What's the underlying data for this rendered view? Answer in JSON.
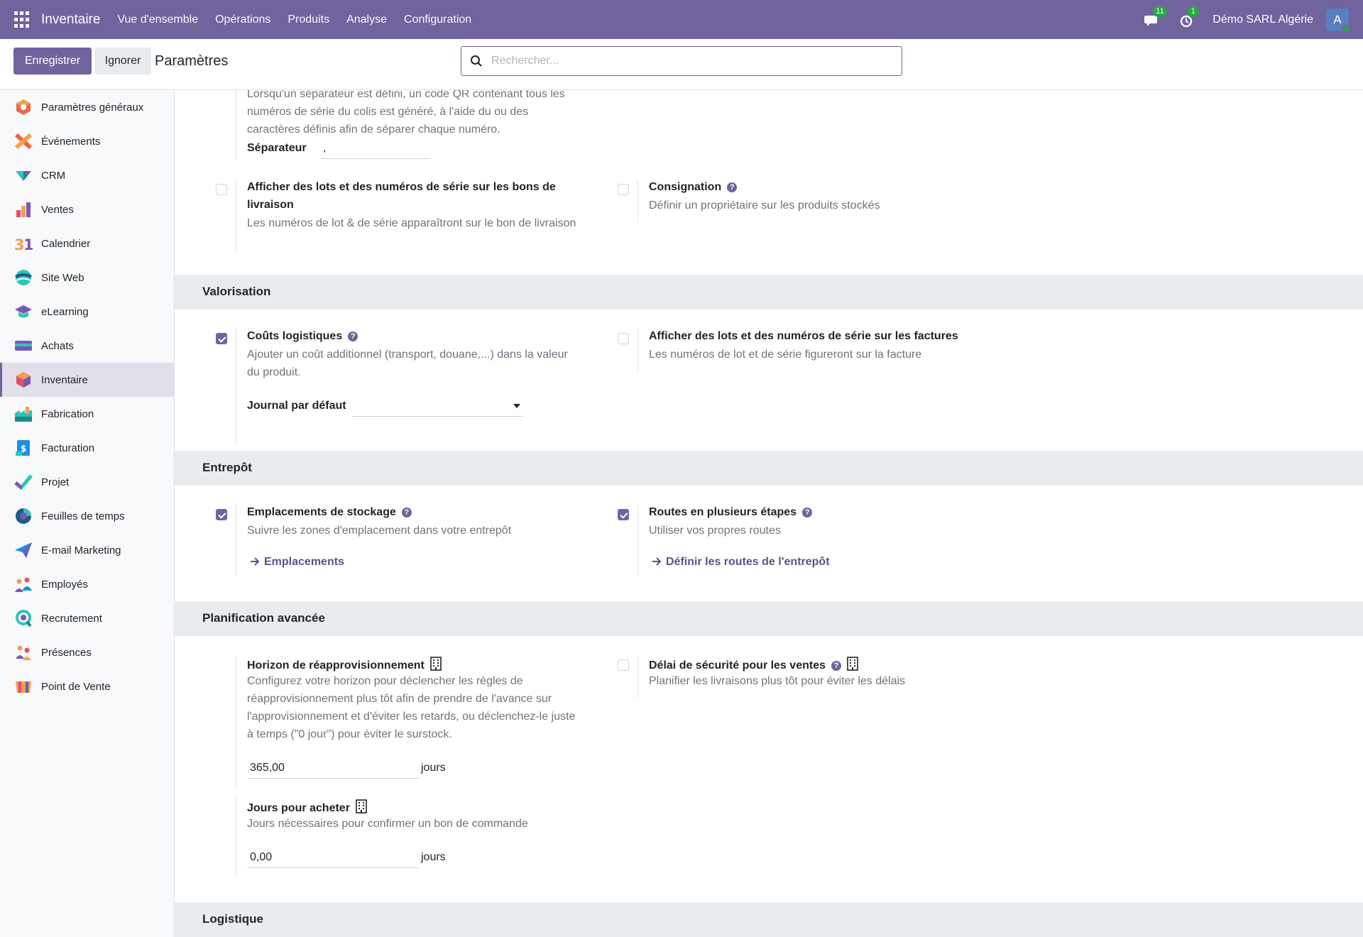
{
  "navbar": {
    "app_name": "Inventaire",
    "menu": [
      "Vue d'ensemble",
      "Opérations",
      "Produits",
      "Analyse",
      "Configuration"
    ],
    "messages_count": "11",
    "activities_count": "1",
    "company": "Démo SARL Algérie",
    "avatar_letter": "A",
    "colors": {
      "brand": "#71639e",
      "badge": "#28a745"
    }
  },
  "control": {
    "save_label": "Enregistrer",
    "discard_label": "Ignorer",
    "title": "Paramètres",
    "search_placeholder": "Rechercher..."
  },
  "sidebar": {
    "items": [
      {
        "label": "Paramètres généraux",
        "icon": "settings-app-icon"
      },
      {
        "label": "Événements",
        "icon": "events-app-icon"
      },
      {
        "label": "CRM",
        "icon": "crm-app-icon"
      },
      {
        "label": "Ventes",
        "icon": "sales-app-icon"
      },
      {
        "label": "Calendrier",
        "icon": "calendar-app-icon"
      },
      {
        "label": "Site Web",
        "icon": "website-app-icon"
      },
      {
        "label": "eLearning",
        "icon": "elearning-app-icon"
      },
      {
        "label": "Achats",
        "icon": "purchase-app-icon"
      },
      {
        "label": "Inventaire",
        "icon": "inventory-app-icon",
        "active": true
      },
      {
        "label": "Fabrication",
        "icon": "manufacturing-app-icon"
      },
      {
        "label": "Facturation",
        "icon": "invoicing-app-icon"
      },
      {
        "label": "Projet",
        "icon": "project-app-icon"
      },
      {
        "label": "Feuilles de temps",
        "icon": "timesheets-app-icon"
      },
      {
        "label": "E-mail Marketing",
        "icon": "email-marketing-app-icon"
      },
      {
        "label": "Employés",
        "icon": "employees-app-icon"
      },
      {
        "label": "Recrutement",
        "icon": "recruitment-app-icon"
      },
      {
        "label": "Présences",
        "icon": "attendances-app-icon"
      },
      {
        "label": "Point de Vente",
        "icon": "pos-app-icon"
      }
    ]
  },
  "main": {
    "top_block": {
      "desc_lines": [
        "Lorsqu'un séparateur est défini, un code QR contenant tous les",
        "numéros de série du colis est généré, à l'aide du ou des",
        "caractères définis afin de séparer chaque numéro."
      ],
      "separator_label": "Séparateur",
      "separator_value": ","
    },
    "lots_delivery": {
      "title_line1": "Afficher des lots et des numéros de série sur les bons de",
      "title_line2": "livraison",
      "desc": "Les numéros de lot & de série apparaîtront sur le bon de livraison",
      "checked": false
    },
    "consignment": {
      "title": "Consignation",
      "desc": "Définir un propriétaire sur les produits stockés",
      "checked": false
    },
    "valuation": {
      "section_title": "Valorisation",
      "landed_costs": {
        "title": "Coûts logistiques",
        "desc_line1": "Ajouter un coût additionnel (transport, douane,...) dans la valeur",
        "desc_line2": "du produit.",
        "journal_label": "Journal par défaut",
        "journal_value": "",
        "checked": true
      },
      "lots_invoices": {
        "title": "Afficher des lots et des numéros de série sur les factures",
        "desc": "Les numéros de lot et de série figureront sur la facture",
        "checked": false
      }
    },
    "warehouse": {
      "section_title": "Entrepôt",
      "locations": {
        "title": "Emplacements de stockage",
        "desc": "Suivre les zones d'emplacement dans votre entrepôt",
        "link": "Emplacements",
        "checked": true
      },
      "routes": {
        "title": "Routes en plusieurs étapes",
        "desc": "Utiliser vos propres routes",
        "link": "Définir les routes de l'entrepôt",
        "checked": true
      }
    },
    "planning": {
      "section_title": "Planification avancée",
      "horizon": {
        "title": "Horizon de réapprovisionnement",
        "desc_lines": [
          "Configurez votre horizon pour déclencher les règles de",
          "réapprovisionnement plus tôt afin de prendre de l'avance sur",
          "l'approvisionnement et d'éviter les retards, ou déclenchez-le juste",
          "à temps (\"0 jour\") pour éviter le surstock."
        ],
        "value": "365,00",
        "unit": "jours"
      },
      "security_lead": {
        "title": "Délai de sécurité pour les ventes",
        "desc": "Planifier les livraisons plus tôt pour éviter les délais",
        "checked": false
      },
      "purchase_days": {
        "title": "Jours pour acheter",
        "desc": "Jours nécessaires pour confirmer un bon de commande",
        "value": "0,00",
        "unit": "jours"
      }
    },
    "logistics": {
      "section_title": "Logistique"
    }
  }
}
